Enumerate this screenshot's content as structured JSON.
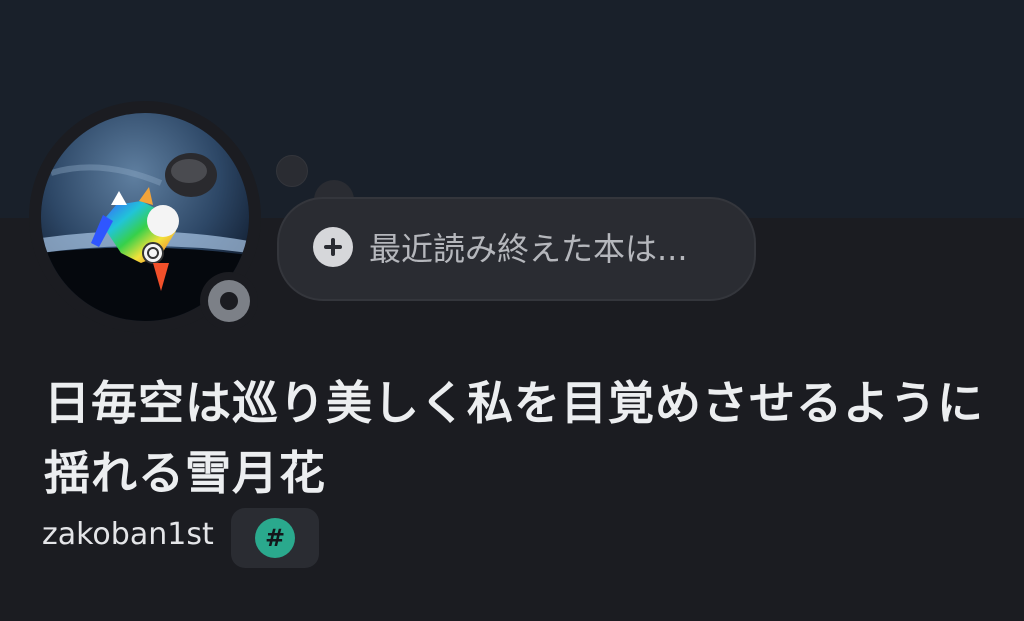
{
  "profile": {
    "custom_status_placeholder": "最近読み終えた本は...",
    "display_name": "日毎空は巡り美しく私を目覚めさせるように揺れる雪月花",
    "username": "zakoban1st",
    "badge_symbol": "#",
    "status": "offline"
  },
  "icons": {
    "add_status": "plus-circle-icon",
    "badge": "hashtag-icon"
  },
  "colors": {
    "banner": "#19202a",
    "background": "#1b1c21",
    "bubble": "#2a2c32",
    "badge_accent": "#2aa98d",
    "status_offline": "#7c8087"
  }
}
